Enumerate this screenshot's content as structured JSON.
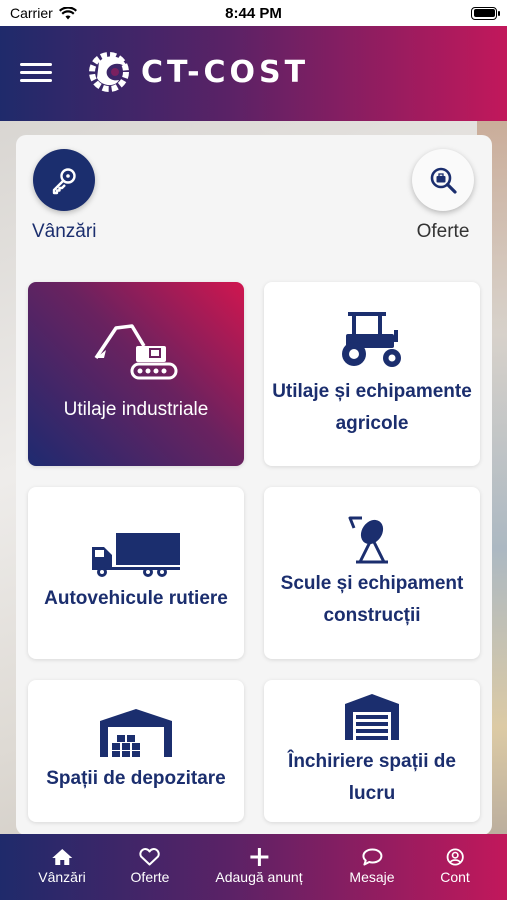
{
  "status_bar": {
    "carrier": "Carrier",
    "time": "8:44 PM"
  },
  "header": {
    "brand": "CT-COST"
  },
  "quick_actions": [
    {
      "label": "Vânzări",
      "icon": "key-icon"
    },
    {
      "label": "Oferte",
      "icon": "search-briefcase-icon"
    }
  ],
  "categories": [
    {
      "label": "Utilaje industriale",
      "icon": "excavator-icon",
      "active": true
    },
    {
      "label": "Utilaje și echipamente agricole",
      "icon": "tractor-icon",
      "active": false
    },
    {
      "label": "Autovehicule rutiere",
      "icon": "truck-icon",
      "active": false
    },
    {
      "label": "Scule și echipament construcții",
      "icon": "concrete-mixer-icon",
      "active": false
    },
    {
      "label": "Spații de depozitare",
      "icon": "warehouse-icon",
      "active": false
    },
    {
      "label": "Închiriere spații de lucru",
      "icon": "garage-icon",
      "active": false
    }
  ],
  "bottom_nav": [
    {
      "label": "Vânzări",
      "icon": "home-icon"
    },
    {
      "label": "Oferte",
      "icon": "heart-icon"
    },
    {
      "label": "Adaugă anunț",
      "icon": "plus-icon"
    },
    {
      "label": "Mesaje",
      "icon": "chat-icon"
    },
    {
      "label": "Cont",
      "icon": "user-icon"
    }
  ],
  "colors": {
    "primary_blue": "#1b2e6e",
    "accent_pink": "#c2185b",
    "gradient_start": "#1f2a6b",
    "gradient_end": "#c2185b"
  }
}
